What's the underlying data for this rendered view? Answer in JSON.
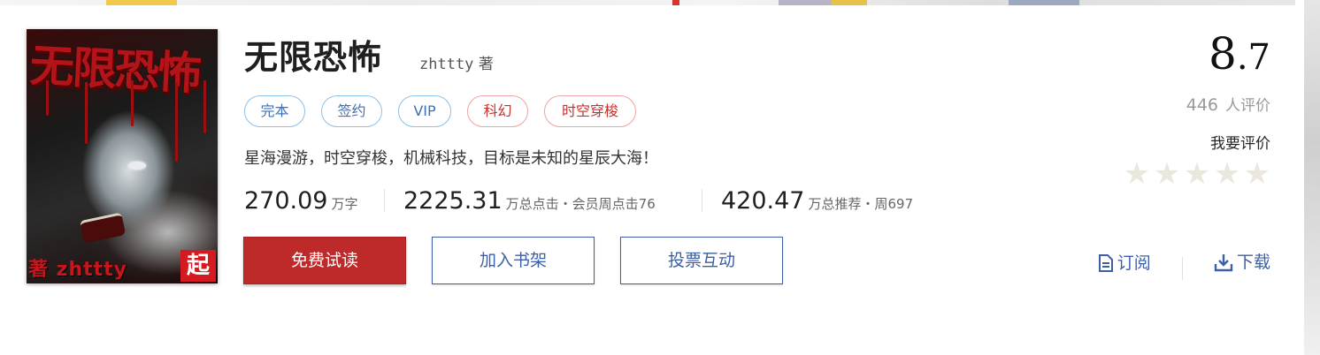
{
  "book": {
    "title": "无限恐怖",
    "author": "zhttty",
    "author_suffix": "著",
    "intro": "星海漫游，时空穿梭，机械科技，目标是未知的星辰大海！",
    "cover": {
      "title_text": "无限恐怖",
      "author_text": "著 zhttty",
      "badge_text": "起"
    }
  },
  "tags": [
    {
      "label": "完本",
      "style": "blue"
    },
    {
      "label": "签约",
      "style": "blue"
    },
    {
      "label": "VIP",
      "style": "blue"
    },
    {
      "label": "科幻",
      "style": "red"
    },
    {
      "label": "时空穿梭",
      "style": "red"
    }
  ],
  "stats": {
    "words": {
      "num": "270.09",
      "unit": "万字"
    },
    "clicks": {
      "num": "2225.31",
      "unit": "万总点击・会员周点击76"
    },
    "recommends": {
      "num": "420.47",
      "unit": "万总推荐・周697"
    }
  },
  "buttons": {
    "read": "免费试读",
    "shelf": "加入书架",
    "vote": "投票互动"
  },
  "rating": {
    "score_int": "8",
    "score_dec": ".7",
    "count": "446",
    "count_label": "人评价",
    "rate_link": "我要评价",
    "stars_total": 5,
    "star_color": "#ebe7dd"
  },
  "actions": {
    "subscribe": "订阅",
    "download": "下载"
  },
  "colors": {
    "accent_red": "#be2a2a",
    "link_blue": "#3c5fa5",
    "tag_blue_border": "#8fc0e6",
    "tag_red_border": "#eba5a3"
  }
}
